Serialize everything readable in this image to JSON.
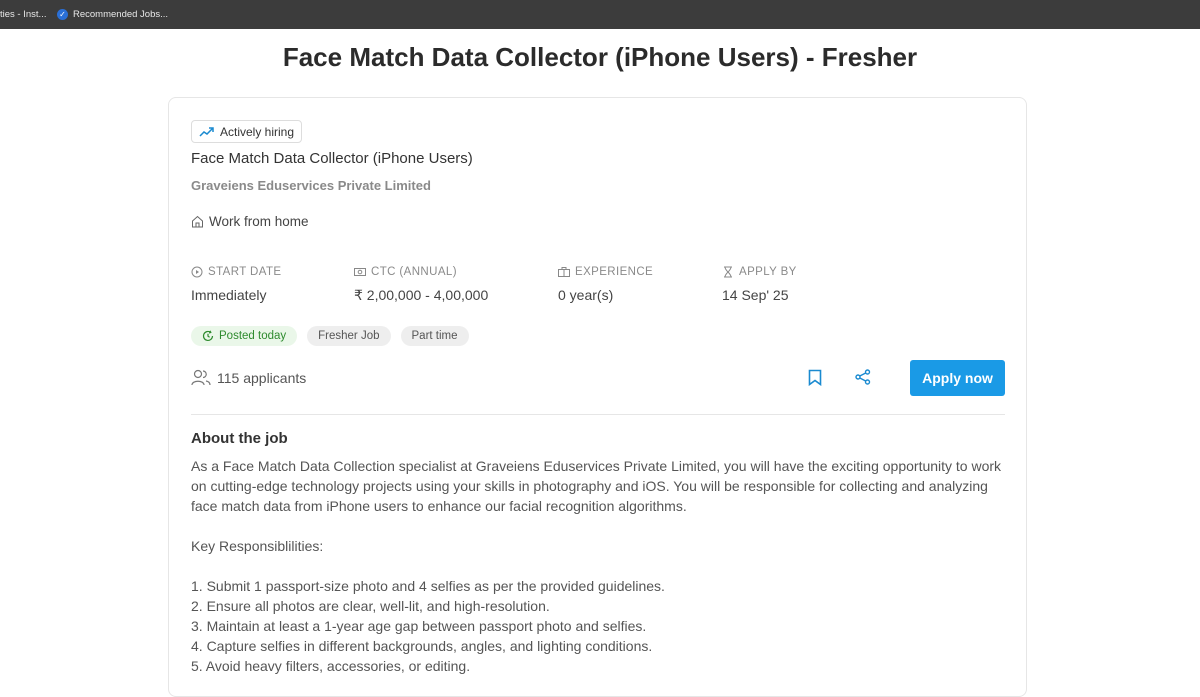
{
  "bookmarks": [
    {
      "label": "ties - Inst..."
    },
    {
      "label": "Recommended Jobs..."
    }
  ],
  "page": {
    "title": "Face Match Data Collector (iPhone Users) - Fresher"
  },
  "job": {
    "badge": "Actively hiring",
    "title": "Face Match Data Collector (iPhone Users)",
    "company": "Graveiens Eduservices Private Limited",
    "location": "Work from home",
    "meta": {
      "start_label": "START DATE",
      "start_value": "Immediately",
      "ctc_label": "CTC (ANNUAL)",
      "ctc_value": "₹ 2,00,000 - 4,00,000",
      "exp_label": "EXPERIENCE",
      "exp_value": "0 year(s)",
      "apply_label": "APPLY BY",
      "apply_value": "14 Sep' 25"
    },
    "tags": [
      "Posted today",
      "Fresher Job",
      "Part time"
    ],
    "applicants": "115 applicants",
    "apply_button": "Apply now"
  },
  "about": {
    "heading": "About the job",
    "intro": "As a Face Match Data Collection specialist at Graveiens Eduservices Private Limited, you will have the exciting opportunity to work on cutting-edge technology projects using your skills in photography and iOS. You will be responsible for collecting and analyzing face match data from iPhone users to enhance our facial recognition algorithms.",
    "responsibilities_heading": "Key Responsiblilities:",
    "items": [
      "1. Submit 1 passport-size photo and 4 selfies as per the provided guidelines.",
      "2. Ensure all photos are clear, well-lit, and high-resolution.",
      "3. Maintain at least a 1-year age gap between passport photo and selfies.",
      "4. Capture selfies in different backgrounds, angles, and lighting conditions.",
      "5. Avoid heavy filters, accessories, or editing."
    ]
  },
  "colors": {
    "accent": "#1a9ae6",
    "green_tag": "#2e8b2e",
    "topbar": "#3c3c3c"
  }
}
